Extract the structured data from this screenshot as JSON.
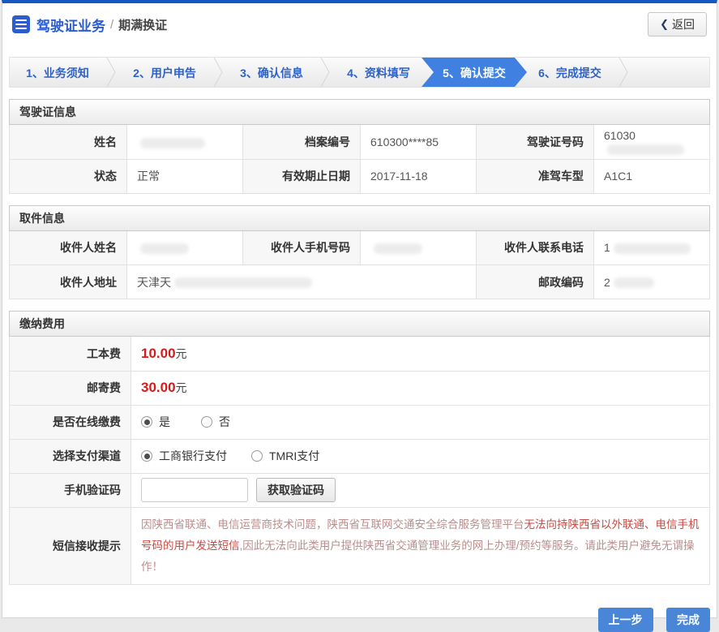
{
  "header": {
    "title": "驾驶证业务",
    "separator": "/",
    "subtitle": "期满换证",
    "back_label": "返回",
    "back_chevron": "❮"
  },
  "tabs": [
    {
      "label": "1、业务须知",
      "active": false
    },
    {
      "label": "2、用户申告",
      "active": false
    },
    {
      "label": "3、确认信息",
      "active": false
    },
    {
      "label": "4、资料填写",
      "active": false
    },
    {
      "label": "5、确认提交",
      "active": true
    },
    {
      "label": "6、完成提交",
      "active": false
    }
  ],
  "sections": {
    "license": {
      "title": "驾驶证信息",
      "fields": [
        {
          "label": "姓名",
          "value": "",
          "masked": true
        },
        {
          "label": "档案编号",
          "value": "610300****85",
          "masked": false
        },
        {
          "label": "驾驶证号码",
          "value": "61030",
          "masked": true
        },
        {
          "label": "状态",
          "value": "正常",
          "masked": false
        },
        {
          "label": "有效期止日期",
          "value": "2017-11-18",
          "masked": false
        },
        {
          "label": "准驾车型",
          "value": "A1C1",
          "masked": false
        }
      ]
    },
    "pickup": {
      "title": "取件信息",
      "fields": [
        {
          "label": "收件人姓名",
          "value": "",
          "masked": true
        },
        {
          "label": "收件人手机号码",
          "value": "",
          "masked": true
        },
        {
          "label": "收件人联系电话",
          "value": "1",
          "masked": true
        },
        {
          "label": "收件人地址",
          "value": "天津天",
          "masked": true
        },
        {
          "label": "邮政编码",
          "value": "2",
          "masked": true
        }
      ]
    },
    "fees": {
      "title": "缴纳费用",
      "rows": {
        "work_fee": {
          "label": "工本费",
          "amount": "10.00",
          "unit": "元"
        },
        "post_fee": {
          "label": "邮寄费",
          "amount": "30.00",
          "unit": "元"
        },
        "online_pay": {
          "label": "是否在线缴费",
          "options": [
            {
              "label": "是",
              "selected": true
            },
            {
              "label": "否",
              "selected": false
            }
          ]
        },
        "channel": {
          "label": "选择支付渠道",
          "options": [
            {
              "label": "工商银行支付",
              "selected": true
            },
            {
              "label": "TMRI支付",
              "selected": false
            }
          ]
        },
        "sms_code": {
          "label": "手机验证码",
          "input_value": "",
          "button_label": "获取验证码"
        },
        "sms_notice": {
          "label": "短信接收提示",
          "segments": [
            {
              "text": "因陕西省联通、电信运营商技术问题，陕西省互联网交通安全综合服务管理平台",
              "emphasis": false
            },
            {
              "text": "无法向持陕西省以外联通、电信手机号码的用户发送短信",
              "emphasis": true
            },
            {
              "text": ",因此无法向此类用户提供陕西省交通管理业务的网上办理/预约等服务。请此类用户避免无谓操作！",
              "emphasis": false
            }
          ]
        }
      }
    }
  },
  "footer": {
    "prev_label": "上一步",
    "finish_label": "完成"
  },
  "colors": {
    "top_accent": "#1757c2",
    "title_blue": "#2b5cd0",
    "tab_text_blue": "#2e62c9",
    "tab_active_bg": "#3f80e0",
    "fee_red": "#cf1d1d",
    "notice_muted": "#b98e8c",
    "notice_emphasis": "#c94a43",
    "action_button_blue": "#4a86d8"
  }
}
